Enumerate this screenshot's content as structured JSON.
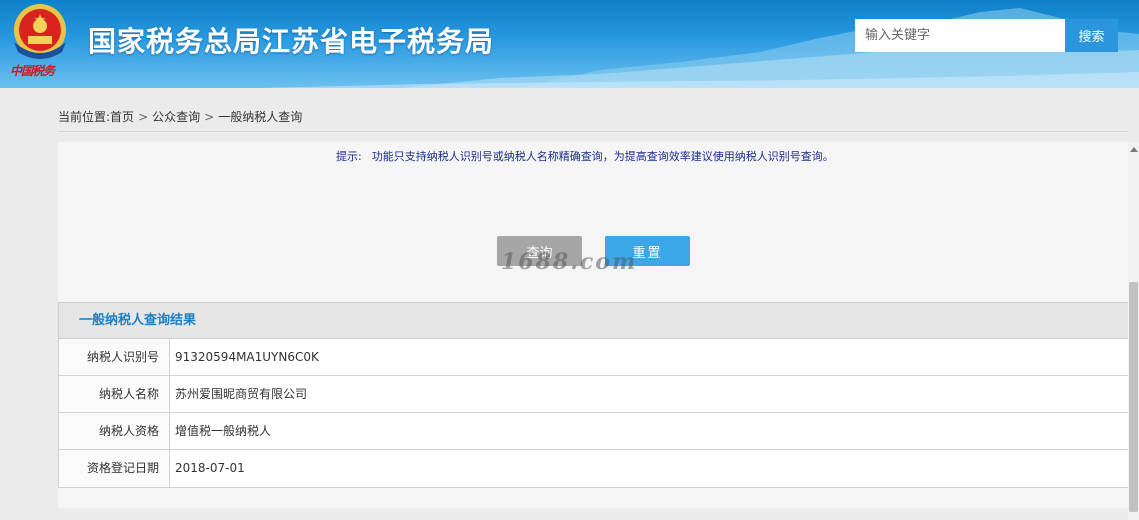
{
  "header": {
    "emblem_text": "中国税务",
    "site_title": "国家税务总局江苏省电子税务局",
    "search_placeholder": "输入关键字",
    "search_button": "搜索"
  },
  "breadcrumb": {
    "prefix": "当前位置:",
    "items": [
      "首页",
      "公众查询",
      "一般纳税人查询"
    ],
    "separator": ">"
  },
  "query": {
    "tip_prefix": "提示:",
    "tip": "功能只支持纳税人识别号或纳税人名称精确查询，为提高查询效率建议使用纳税人识别号查询。",
    "query_button": "查询",
    "reset_button": "重置",
    "watermark": "1688.com"
  },
  "result": {
    "title": "一般纳税人查询结果",
    "rows": [
      {
        "label": "纳税人识别号",
        "value": "91320594MA1UYN6C0K"
      },
      {
        "label": "纳税人名称",
        "value": "苏州爱围昵商贸有限公司"
      },
      {
        "label": "纳税人资格",
        "value": "增值税一般纳税人"
      },
      {
        "label": "资格登记日期",
        "value": "2018-07-01"
      }
    ]
  },
  "colors": {
    "header_blue": "#0d7fc8",
    "search_button": "#2b96de",
    "reset_button": "#3ba6e8",
    "query_button": "#a6a6a6",
    "result_title": "#1e7fc4",
    "tip_text": "#1b2c8c"
  }
}
